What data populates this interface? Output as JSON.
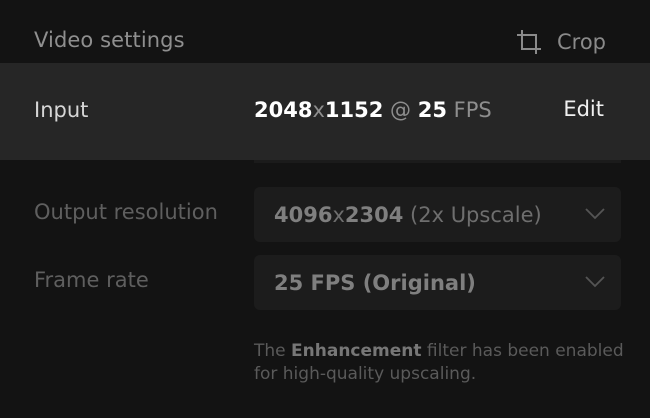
{
  "header": {
    "title": "Video settings",
    "crop_label": "Crop",
    "crop_icon": "crop-icon"
  },
  "input": {
    "label": "Input",
    "width": "2048",
    "x": "x",
    "height": "1152",
    "at": "@",
    "fps_value": "25",
    "fps_unit": "FPS",
    "edit_label": "Edit"
  },
  "output_resolution": {
    "label": "Output resolution",
    "width": "4096",
    "x": "x",
    "height": "2304",
    "suffix": "(2x Upscale)",
    "icon": "chevron-down-icon"
  },
  "frame_rate": {
    "label": "Frame rate",
    "value": "25 FPS (Original)",
    "icon": "chevron-down-icon"
  },
  "note": {
    "prefix": "The",
    "filter": "Enhancement",
    "suffix": "filter has been enabled for high-quality upscaling."
  },
  "colors": {
    "background": "#131313",
    "input_row": "#262626",
    "select_bg": "#1c1c1c",
    "text_primary": "#ffffff",
    "text_dim": "#5f5f5f"
  }
}
